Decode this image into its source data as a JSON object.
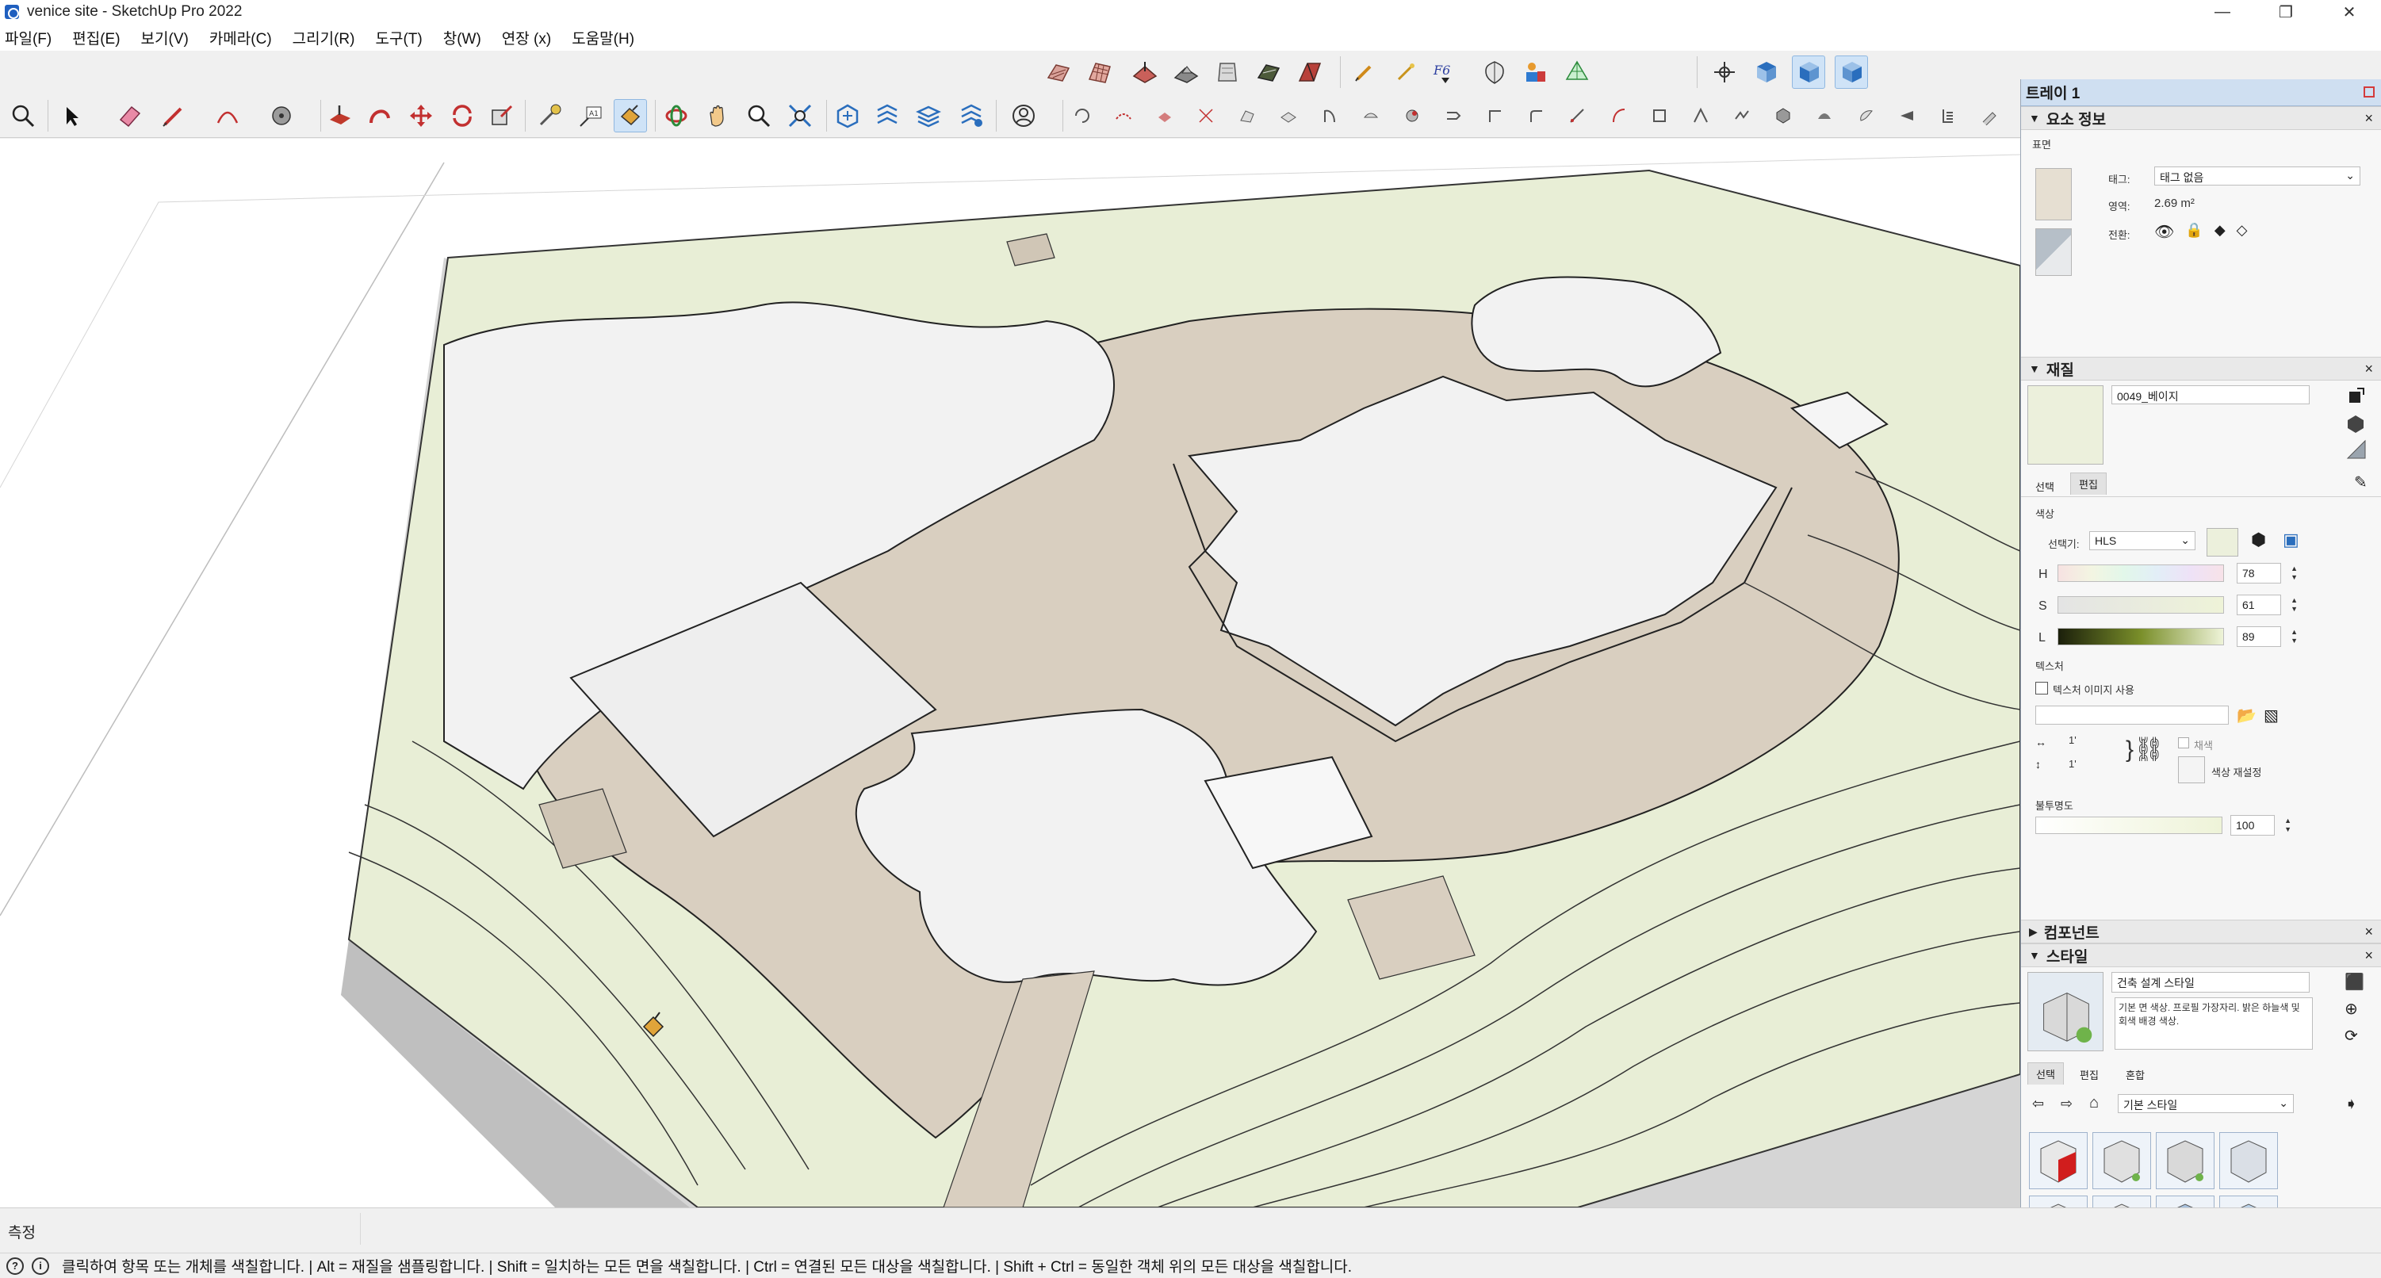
{
  "window": {
    "title": "venice site - SketchUp Pro 2022",
    "controls": [
      "—",
      "❐",
      "✕"
    ]
  },
  "menu": [
    "파일(F)",
    "편집(E)",
    "보기(V)",
    "카메라(C)",
    "그리기(R)",
    "도구(T)",
    "창(W)",
    "연장 (x)",
    "도움말(H)"
  ],
  "toolbar": {
    "active_tool": "paint-bucket"
  },
  "tray": {
    "title": "트레이 1",
    "entity_info": {
      "header": "요소 정보",
      "kind": "표면",
      "tag_label": "태그:",
      "tag_value": "태그 없음",
      "area_label": "영역:",
      "area_value": "2.69 m²",
      "toggle_label": "전환:"
    },
    "materials": {
      "header": "재질",
      "material_name": "0049_베이지",
      "tab_select": "선택",
      "tab_edit": "편집",
      "color_label": "색상",
      "picker_label": "선택기:",
      "picker_value": "HLS",
      "h_label": "H",
      "h_value": "78",
      "s_label": "S",
      "s_value": "61",
      "l_label": "L",
      "l_value": "89",
      "texture_label": "텍스처",
      "texture_checkbox": "텍스처 이미지 사용",
      "width_value": "1'",
      "height_value": "1'",
      "colorize_label": "채색",
      "reset_color_label": "색상 재설정",
      "opacity_label": "불투명도",
      "opacity_value": "100",
      "swatch_color": "#ecf0dc"
    },
    "components": {
      "header": "컴포넌트"
    },
    "styles": {
      "header": "스타일",
      "style_name": "건축 설계 스타일",
      "style_desc": "기본 면 색상. 프로필 가장자리. 밝은 하늘색 및 회색 배경 색상.",
      "tab_select": "선택",
      "tab_edit": "편집",
      "tab_mix": "혼합",
      "collection": "기본 스타일"
    }
  },
  "status": {
    "measure_label": "측정",
    "message": "클릭하여 항목 또는 개체를 색칠합니다. | Alt = 재질을 샘플링합니다. | Shift = 일치하는 모든 면을 색칠합니다. | Ctrl = 연결된 모든 대상을 색칠합니다. | Shift + Ctrl = 동일한 객체 위의 모든 대상을 색칠합니다."
  },
  "colors": {
    "terrain_green": "#e8eed6",
    "path_beige": "#d9cfc0",
    "white_face": "#f2f2f2",
    "wall_side": "#d8d8d8",
    "accent_blue": "#2a6ebd"
  }
}
